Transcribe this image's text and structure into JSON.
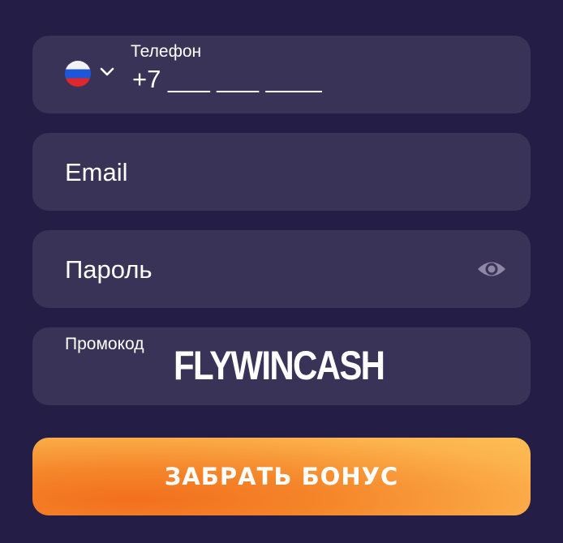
{
  "form": {
    "phone": {
      "label": "Телефон",
      "value": "+7 ___ ___ ____",
      "country_icon": "russia-flag-icon",
      "dropdown_icon": "chevron-down-icon"
    },
    "email": {
      "placeholder": "Email"
    },
    "password": {
      "placeholder": "Пароль",
      "toggle_icon": "eye-icon"
    },
    "promo": {
      "label": "Промокод",
      "value": "FLYWINCASH"
    },
    "submit_label": "ЗАБРАТЬ БОНУС"
  },
  "colors": {
    "background": "#241e47",
    "field": "#3a3358",
    "button_start": "#f26f1e",
    "button_end": "#fdbd55"
  }
}
